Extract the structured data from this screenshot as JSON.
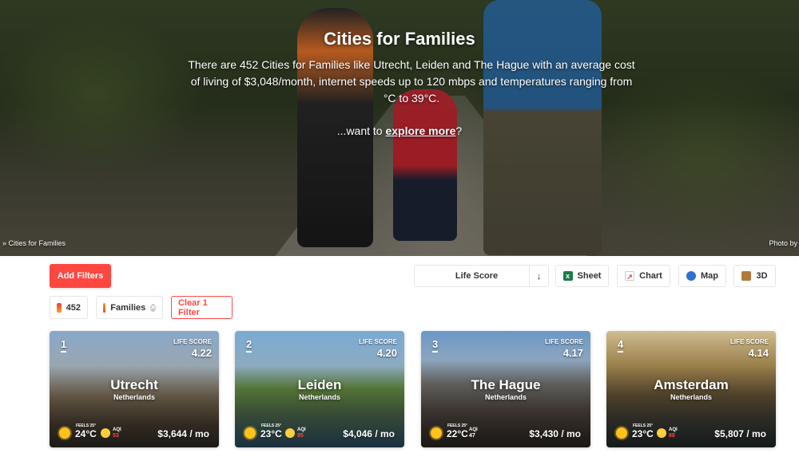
{
  "hero": {
    "title": "Cities for Families",
    "description": "There are 452 Cities for Families like Utrecht, Leiden and The Hague with an average cost of living of $3,048/month, internet speeds up to 120 mbps and temperatures ranging from °C to 39°C.",
    "cta_prefix": "...want to ",
    "cta_link": "explore more",
    "cta_suffix": "?",
    "breadcrumb": "» Cities for Families",
    "photo_credit": "Photo by"
  },
  "toolbar": {
    "add_filters": "Add Filters",
    "sort_label": "Life Score",
    "sort_arrow": "↓",
    "sheet": "Sheet",
    "chart": "Chart",
    "map": "Map",
    "three_d": "3D",
    "colors": {
      "accent": "#ff4742",
      "sheet": "#1e7b45",
      "map": "#2f6fd0",
      "three_d": "#b07a3a"
    }
  },
  "filters": {
    "count": "452",
    "active_filter": "Families",
    "clear": "Clear 1 Filter"
  },
  "cards": [
    {
      "rank": "1",
      "life_score_label": "LIFE SCORE",
      "life_score": "4.22",
      "city": "Utrecht",
      "country": "Netherlands",
      "feels": "FEELS 25°",
      "temp": "24°C",
      "aqi_label": "AQI",
      "aqi": "53",
      "aqi_color": "#ff4742",
      "cost": "$3,644 / mo"
    },
    {
      "rank": "2",
      "life_score_label": "LIFE SCORE",
      "life_score": "4.20",
      "city": "Leiden",
      "country": "Netherlands",
      "feels": "FEELS 25°",
      "temp": "23°C",
      "aqi_label": "AQI",
      "aqi": "95",
      "aqi_color": "#ff4742",
      "cost": "$4,046 / mo"
    },
    {
      "rank": "3",
      "life_score_label": "LIFE SCORE",
      "life_score": "4.17",
      "city": "The Hague",
      "country": "Netherlands",
      "feels": "FEELS 25°",
      "temp": "22°C",
      "aqi_label": "AQI",
      "aqi": "47",
      "aqi_color": "#ffffff",
      "cost": "$3,430 / mo"
    },
    {
      "rank": "4",
      "life_score_label": "LIFE SCORE",
      "life_score": "4.14",
      "city": "Amsterdam",
      "country": "Netherlands",
      "feels": "FEELS 25°",
      "temp": "23°C",
      "aqi_label": "AQI",
      "aqi": "88",
      "aqi_color": "#ff4742",
      "cost": "$5,807 / mo"
    }
  ]
}
